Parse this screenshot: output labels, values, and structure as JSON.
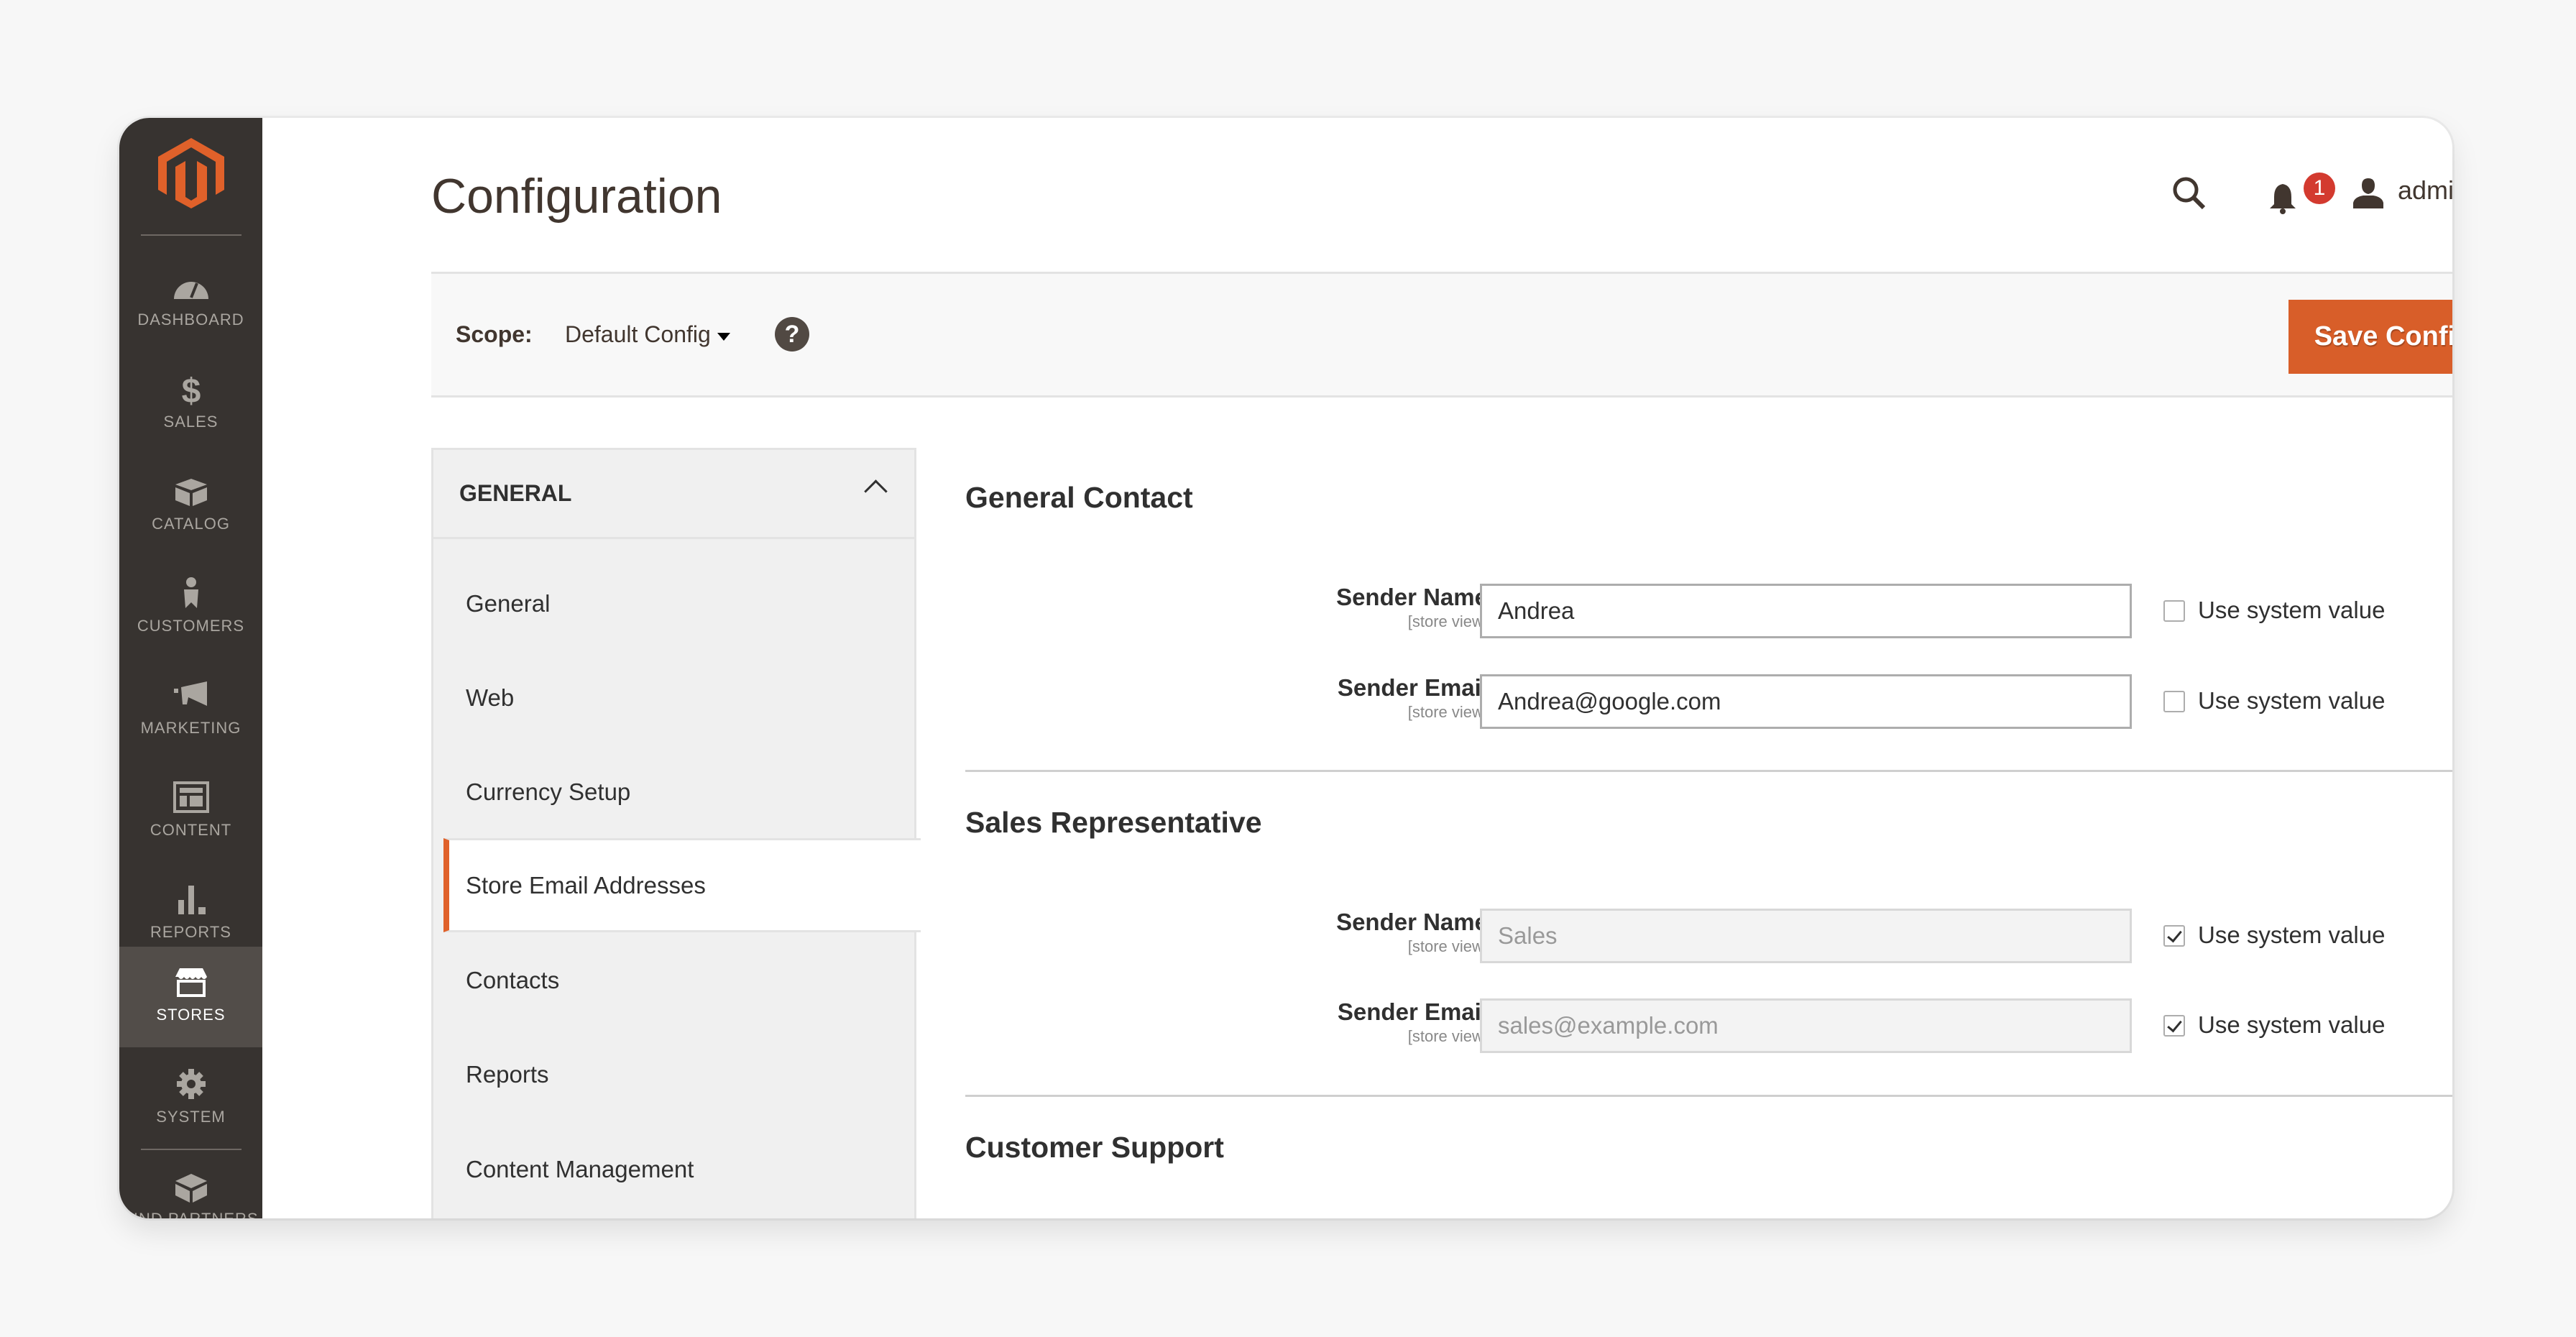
{
  "brand": {
    "accent": "#e0612a",
    "sidebar_bg": "#373330",
    "logo_icon": "magento-logo"
  },
  "sidebar": {
    "items": [
      {
        "label": "DASHBOARD",
        "icon": "dashboard-icon",
        "active": false
      },
      {
        "label": "SALES",
        "icon": "dollar-icon",
        "active": false
      },
      {
        "label": "CATALOG",
        "icon": "box-icon",
        "active": false
      },
      {
        "label": "CUSTOMERS",
        "icon": "person-icon",
        "active": false
      },
      {
        "label": "MARKETING",
        "icon": "megaphone-icon",
        "active": false
      },
      {
        "label": "CONTENT",
        "icon": "layout-icon",
        "active": false
      },
      {
        "label": "REPORTS",
        "icon": "bar-chart-icon",
        "active": false
      },
      {
        "label": "STORES",
        "icon": "store-icon",
        "active": true
      },
      {
        "label": "SYSTEM",
        "icon": "gear-icon",
        "active": false
      },
      {
        "label": "FIND PARTNERS",
        "icon": "blocks-icon",
        "active": false
      }
    ]
  },
  "header": {
    "title": "Configuration",
    "notification_count": "1",
    "user": "admin"
  },
  "scope": {
    "label": "Scope:",
    "value": "Default Config",
    "help": "?",
    "save_label": "Save Config"
  },
  "nav": {
    "group": "GENERAL",
    "items": [
      {
        "label": "General",
        "active": false
      },
      {
        "label": "Web",
        "active": false
      },
      {
        "label": "Currency Setup",
        "active": false
      },
      {
        "label": "Store Email Addresses",
        "active": true
      },
      {
        "label": "Contacts",
        "active": false
      },
      {
        "label": "Reports",
        "active": false
      },
      {
        "label": "Content Management",
        "active": false
      }
    ]
  },
  "sections": [
    {
      "title": "General Contact",
      "fields": [
        {
          "label": "Sender Name",
          "scope": "[store view]",
          "value": "Andrea",
          "use_system": false,
          "system_label": "Use system value"
        },
        {
          "label": "Sender Email",
          "scope": "[store view]",
          "value": "Andrea@google.com",
          "use_system": false,
          "system_label": "Use system value"
        }
      ]
    },
    {
      "title": "Sales Representative",
      "fields": [
        {
          "label": "Sender Name",
          "scope": "[store view]",
          "value": "Sales",
          "use_system": true,
          "system_label": "Use system value"
        },
        {
          "label": "Sender Email",
          "scope": "[store view]",
          "value": "sales@example.com",
          "use_system": true,
          "system_label": "Use system value"
        }
      ]
    },
    {
      "title": "Customer Support",
      "fields": []
    }
  ]
}
